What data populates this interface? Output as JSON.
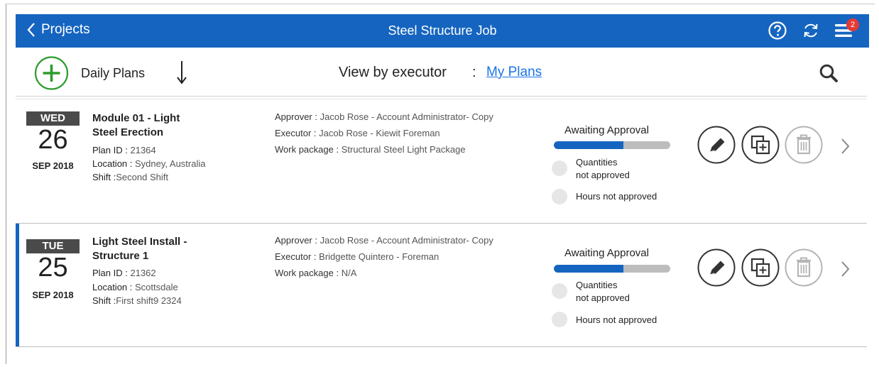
{
  "header": {
    "back_label": "Projects",
    "title": "Steel Structure Job",
    "notification_count": "2",
    "bar_color": "#1565c0"
  },
  "toolbar": {
    "daily_plans_label": "Daily Plans",
    "view_by_label": "View by executor",
    "view_by_colon": ":",
    "view_by_value": "My Plans"
  },
  "labels": {
    "plan_id": "Plan ID :",
    "location": "Location :",
    "shift": "Shift :",
    "approver": "Approver :",
    "executor": "Executor :",
    "work_package": "Work package :",
    "quantities_line1": "Quantities",
    "quantities_line2": "not approved",
    "hours": "Hours not approved"
  },
  "plans": [
    {
      "day": "WED",
      "date": "26",
      "month_year": "SEP 2018",
      "name": "Module 01 - Light Steel Erection",
      "plan_id": "21364",
      "location": "Sydney, Australia",
      "shift": "Second Shift",
      "approver": "Jacob Rose - Account Administrator- Copy",
      "executor": "Jacob Rose - Kiewit Foreman",
      "work_package": "Structural Steel Light Package",
      "status": "Awaiting Approval",
      "progress": 0.6
    },
    {
      "day": "TUE",
      "date": "25",
      "month_year": "SEP 2018",
      "name": "Light Steel Install - Structure 1",
      "plan_id": "21362",
      "location": "Scottsdale",
      "shift": "First shift9 2324",
      "approver": "Jacob Rose - Account Administrator- Copy",
      "executor": "Bridgette Quintero - Foreman",
      "work_package": "N/A",
      "status": "Awaiting Approval",
      "progress": 0.6
    }
  ]
}
